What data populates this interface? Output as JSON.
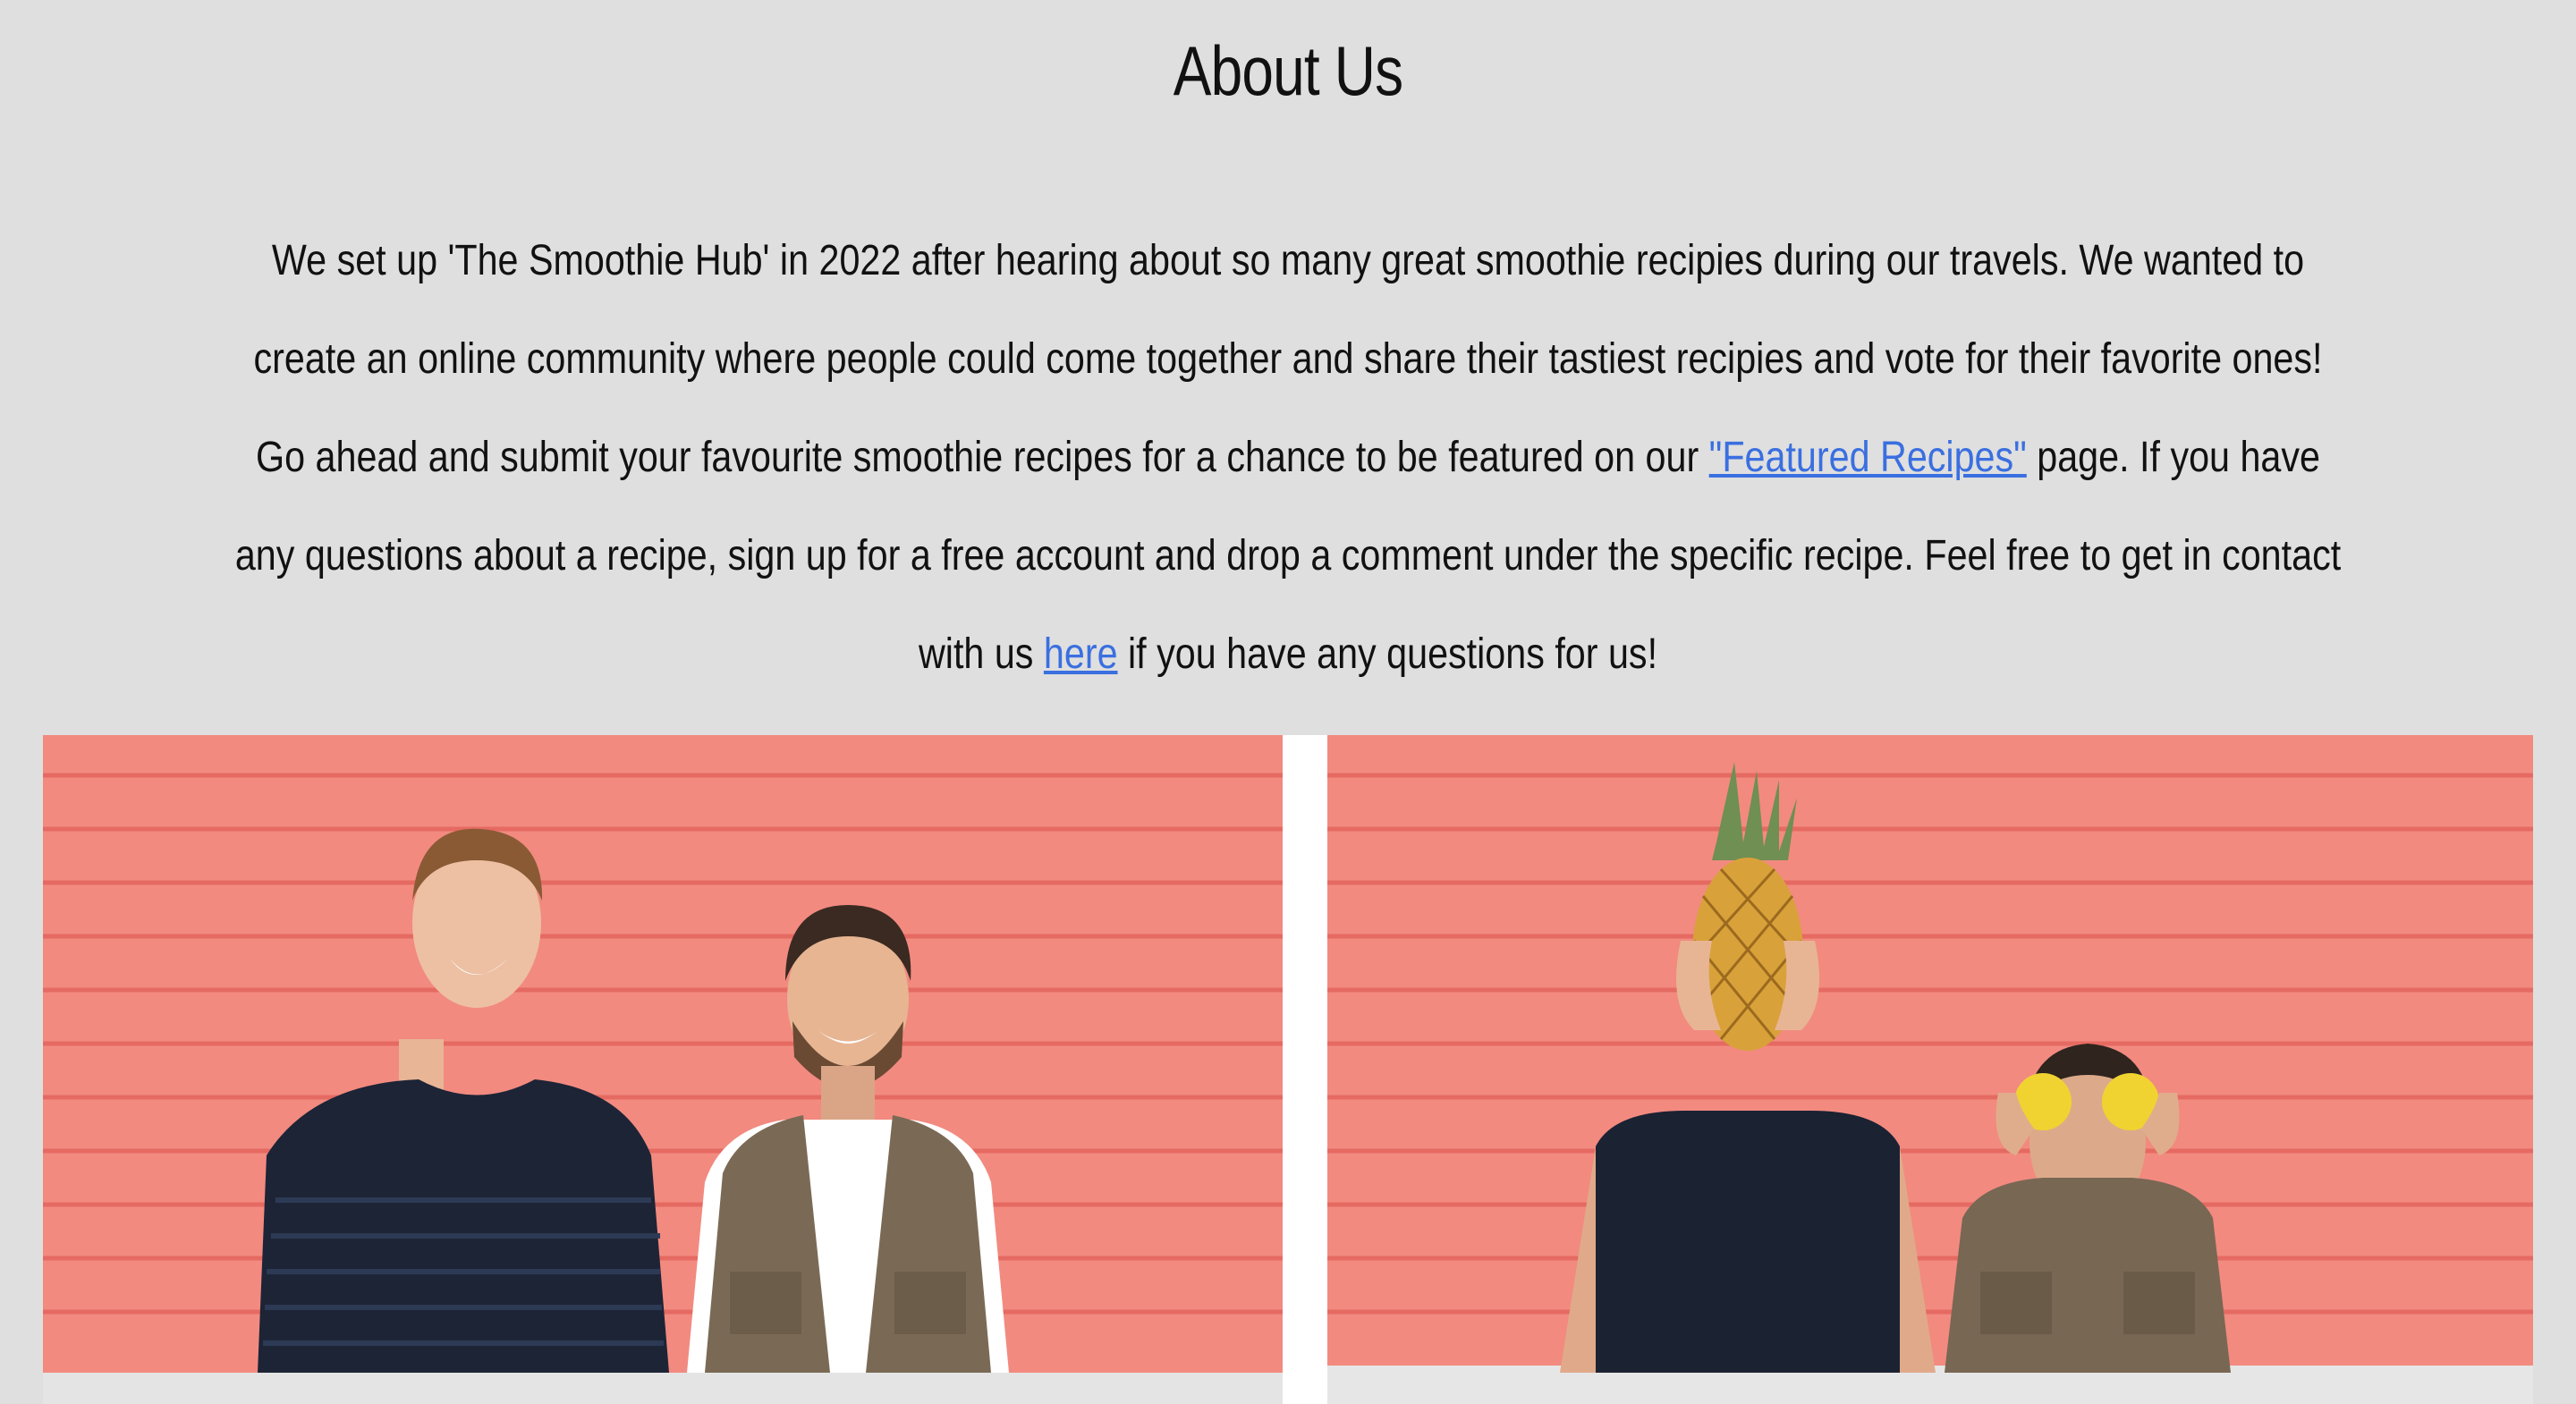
{
  "about": {
    "title": "About Us",
    "text_before_link1": "We set up 'The Smoothie Hub' in 2022 after hearing about so many great smoothie recipies during our travels. We wanted to create an online community where people could come together and share their tastiest recipies and vote for their favorite ones! Go ahead and submit your favourite smoothie recipes for a chance to be featured on our ",
    "link1": "\"Featured Recipes\"",
    "text_between_links": " page. If you have any questions about a recipe, sign up for a free account and drop a comment under the specific recipe. Feel free to get in contact with us ",
    "link2": "here",
    "text_after_link2": " if you have any questions for us!"
  },
  "colors": {
    "background": "#dfdfdf",
    "link": "#3a6fe0",
    "wall": "#f2817a"
  }
}
